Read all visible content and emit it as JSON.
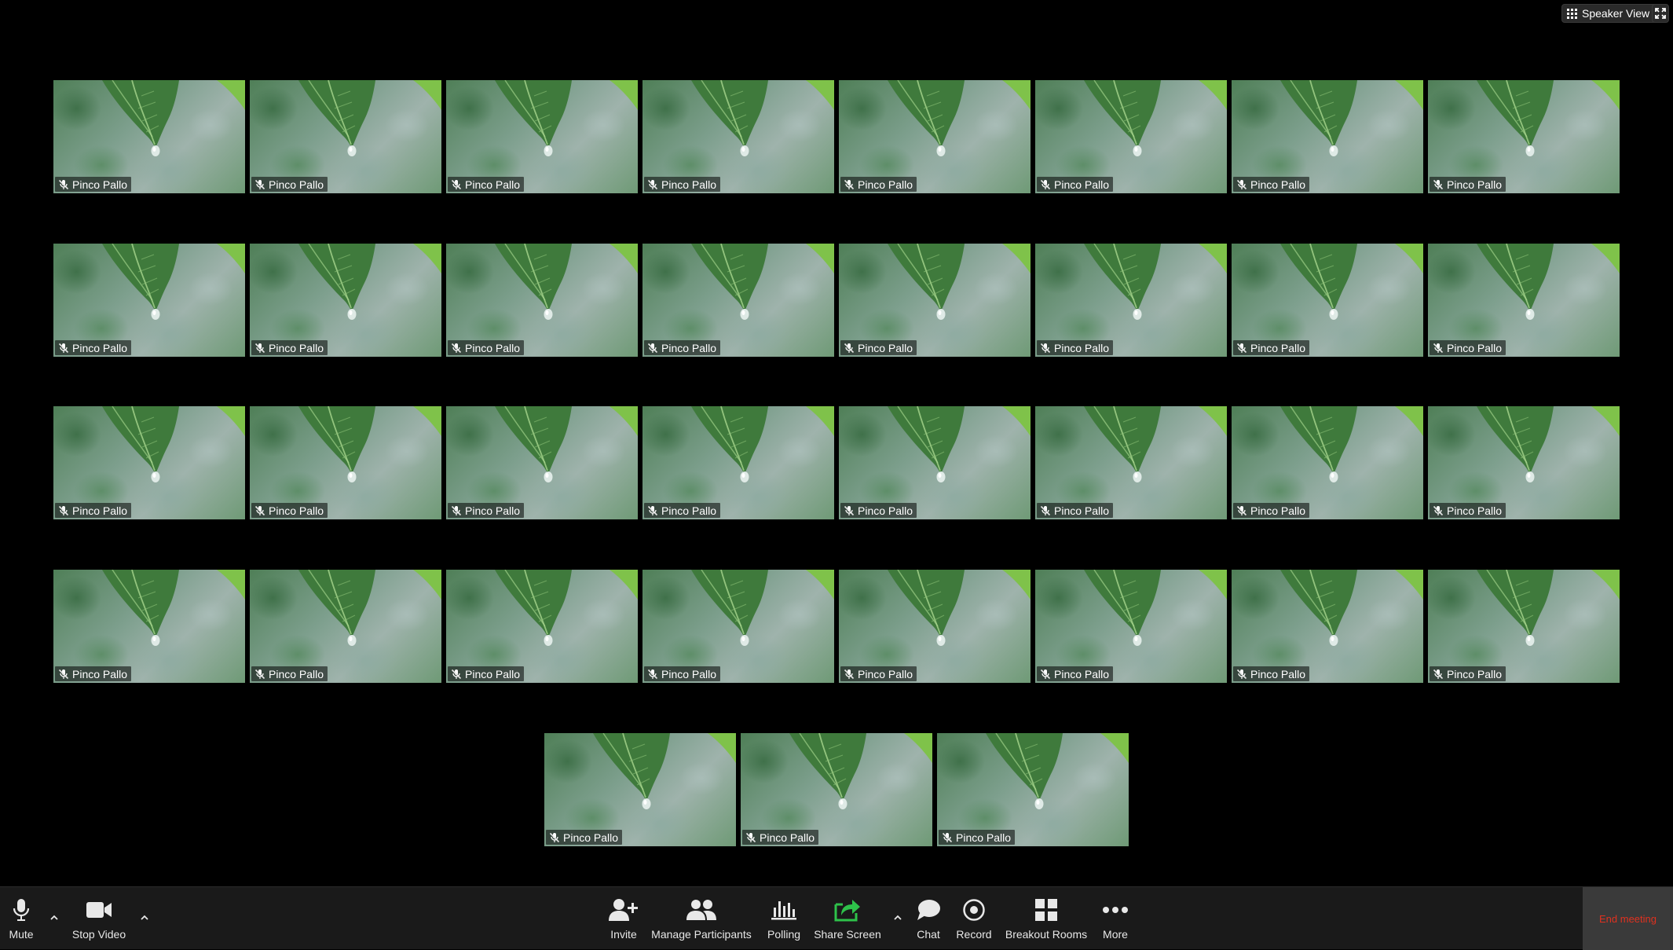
{
  "top_controls": {
    "speaker_view_label": "Speaker View"
  },
  "gallery": {
    "participant_name": "Pinco Pallo",
    "rows": [
      [
        "Pinco Pallo",
        "Pinco Pallo",
        "Pinco Pallo",
        "Pinco Pallo",
        "Pinco Pallo",
        "Pinco Pallo",
        "Pinco Pallo",
        "Pinco Pallo"
      ],
      [
        "Pinco Pallo",
        "Pinco Pallo",
        "Pinco Pallo",
        "Pinco Pallo",
        "Pinco Pallo",
        "Pinco Pallo",
        "Pinco Pallo",
        "Pinco Pallo"
      ],
      [
        "Pinco Pallo",
        "Pinco Pallo",
        "Pinco Pallo",
        "Pinco Pallo",
        "Pinco Pallo",
        "Pinco Pallo",
        "Pinco Pallo",
        "Pinco Pallo"
      ],
      [
        "Pinco Pallo",
        "Pinco Pallo",
        "Pinco Pallo",
        "Pinco Pallo",
        "Pinco Pallo",
        "Pinco Pallo",
        "Pinco Pallo",
        "Pinco Pallo"
      ],
      [
        "Pinco Pallo",
        "Pinco Pallo",
        "Pinco Pallo"
      ]
    ],
    "tile_icon": "muted-microphone-icon"
  },
  "toolbar": {
    "mute_label": "Mute",
    "stop_video_label": "Stop Video",
    "invite_label": "Invite",
    "manage_participants_label": "Manage Participants",
    "polling_label": "Polling",
    "share_screen_label": "Share Screen",
    "chat_label": "Chat",
    "record_label": "Record",
    "breakout_rooms_label": "Breakout Rooms",
    "more_label": "More",
    "end_meeting_label": "End meeting"
  },
  "colors": {
    "background": "#000000",
    "toolbar_bg": "#1a1a1a",
    "share_screen_accent": "#2ec24a",
    "end_meeting_text": "#e0311f"
  }
}
